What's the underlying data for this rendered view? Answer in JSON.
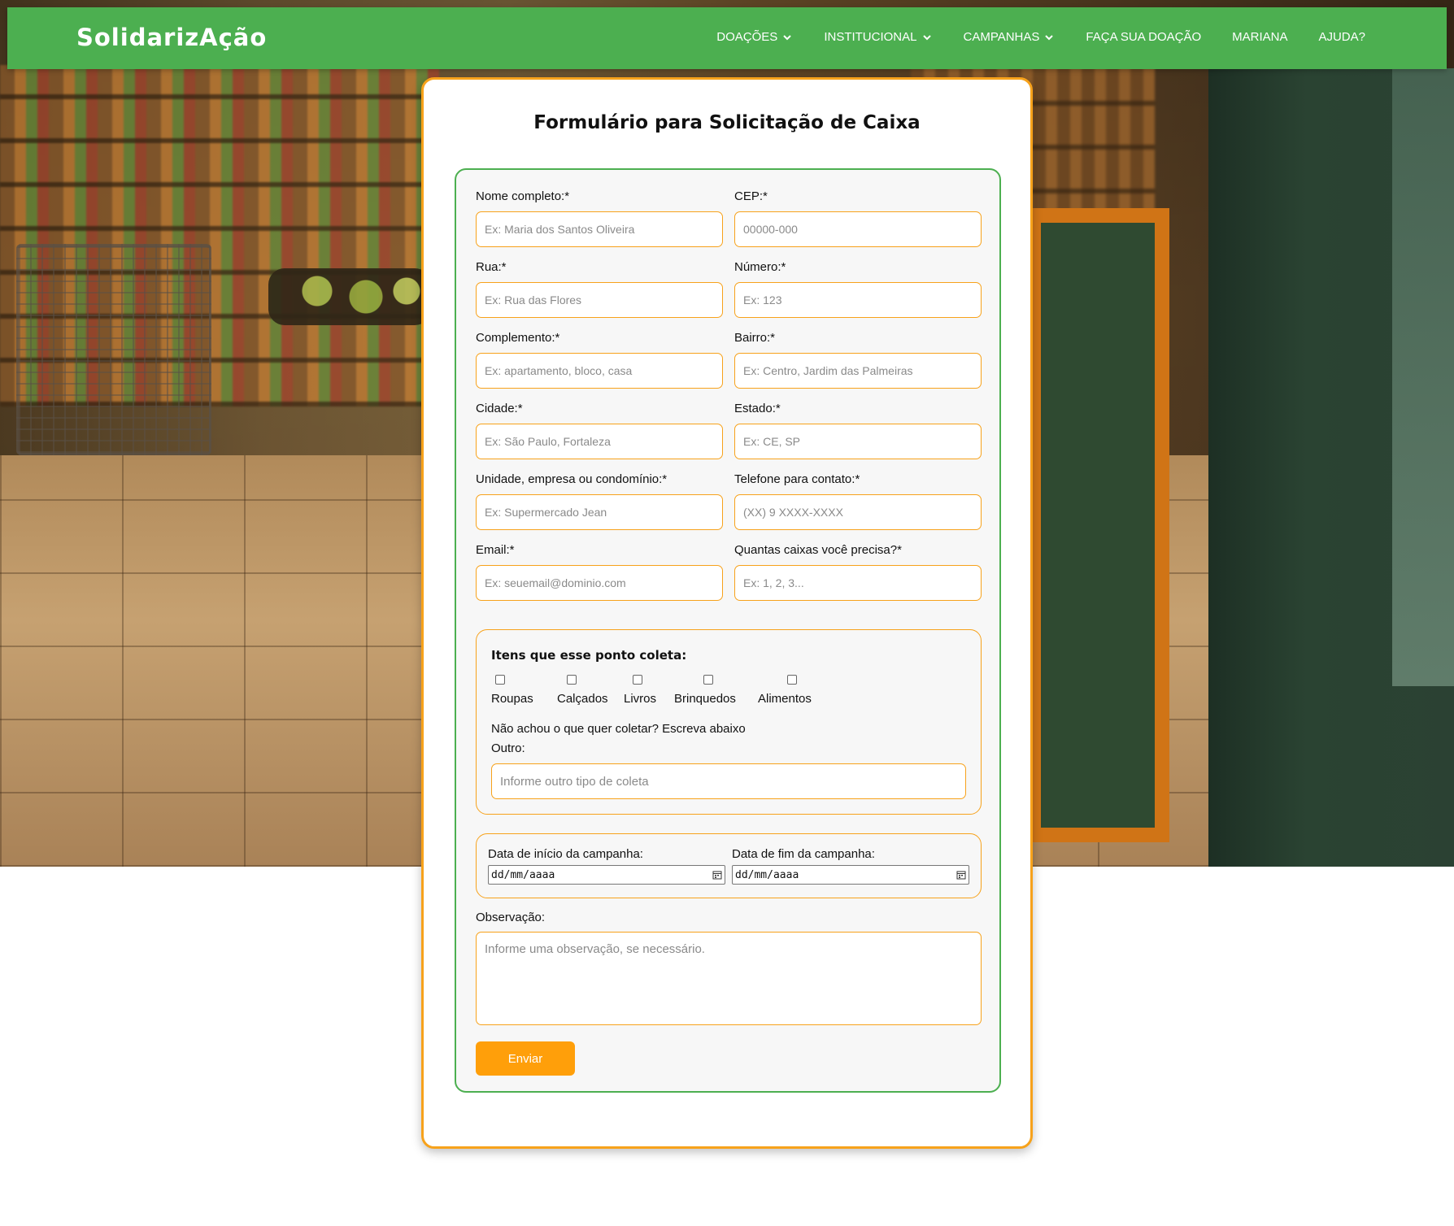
{
  "brand": "SolidarizAção",
  "nav": {
    "items": [
      {
        "label": "DOAÇÕES",
        "has_dropdown": true,
        "icon": "chevron-down-icon"
      },
      {
        "label": "INSTITUCIONAL",
        "has_dropdown": true,
        "icon": "chevron-down-icon"
      },
      {
        "label": "CAMPANHAS",
        "has_dropdown": true,
        "icon": "chevron-down-icon"
      },
      {
        "label": "FAÇA SUA DOAÇÃO",
        "has_dropdown": false
      },
      {
        "label": "MARIANA",
        "has_dropdown": false
      },
      {
        "label": "AJUDA?",
        "has_dropdown": false
      }
    ]
  },
  "form": {
    "title": "Formulário para Solicitação de Caixa",
    "fields": [
      {
        "label": "Nome completo:*",
        "placeholder": "Ex: Maria dos Santos Oliveira"
      },
      {
        "label": "CEP:*",
        "placeholder": "00000-000"
      },
      {
        "label": "Rua:*",
        "placeholder": "Ex: Rua das Flores"
      },
      {
        "label": "Número:*",
        "placeholder": "Ex: 123"
      },
      {
        "label": "Complemento:*",
        "placeholder": "Ex: apartamento, bloco, casa"
      },
      {
        "label": "Bairro:*",
        "placeholder": "Ex: Centro, Jardim das Palmeiras"
      },
      {
        "label": "Cidade:*",
        "placeholder": "Ex: São Paulo, Fortaleza"
      },
      {
        "label": "Estado:*",
        "placeholder": "Ex: CE, SP"
      },
      {
        "label": "Unidade, empresa ou condomínio:*",
        "placeholder": "Ex: Supermercado Jean"
      },
      {
        "label": "Telefone para contato:*",
        "placeholder": "(XX) 9 XXXX-XXXX"
      },
      {
        "label": "Email:*",
        "placeholder": "Ex: seuemail@dominio.com"
      },
      {
        "label": "Quantas caixas você precisa?*",
        "placeholder": "Ex: 1, 2, 3..."
      }
    ],
    "coleta": {
      "title": "Itens que esse ponto coleta:",
      "options": [
        {
          "label": "Roupas",
          "checked": false
        },
        {
          "label": "Calçados",
          "checked": false
        },
        {
          "label": "Livros",
          "checked": false
        },
        {
          "label": "Brinquedos",
          "checked": false
        },
        {
          "label": "Alimentos",
          "checked": false
        }
      ],
      "hint": "Não achou o que quer coletar? Escreva abaixo",
      "outro_label": "Outro:",
      "outro_placeholder": "Informe outro tipo de coleta"
    },
    "dates": {
      "start_label": "Data de início da campanha:",
      "start_value": "dd/mm/aaaa",
      "end_label": "Data de fim da campanha:",
      "end_value": "dd/mm/aaaa",
      "icon": "calendar-icon"
    },
    "observacao": {
      "label": "Observação:",
      "placeholder": "Informe uma observação, se necessário."
    },
    "submit_label": "Enviar"
  },
  "colors": {
    "primary_green": "#4caf50",
    "accent_orange": "#f7a21b",
    "button_orange": "#ff9f0a"
  }
}
